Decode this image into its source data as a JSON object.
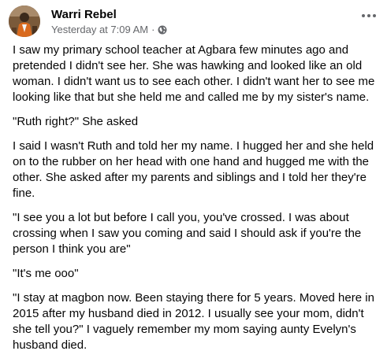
{
  "post": {
    "author": "Warri Rebel",
    "timestamp": "Yesterday at 7:09 AM",
    "separator": "·",
    "privacy_icon": "globe-icon",
    "more_icon": "more-options-icon",
    "paragraphs": [
      "I saw my primary school teacher at Agbara few minutes ago and\npretended I didn't see her. She was hawking and looked like an old\nwoman. I didn't want us to see each other. I didn't want her to see me\nlooking like that but she held me and called me by my sister's name.",
      "\"Ruth right?\" She asked",
      "I said I wasn't Ruth and told her my name. I hugged her and she held\non to the rubber on her head with one hand and hugged me with the\nother. She asked after my parents and siblings and I told her they're\nfine.",
      "\"I see you a lot but before I call you, you've crossed. I was about\ncrossing when I saw you coming and said I should ask if you're the\nperson I think you are\"",
      "\"It's me ooo\"",
      "\"I stay at magbon now. Been staying there for 5 years. Moved here in\n2015 after my husband died in 2012. I usually see your mom, didn't\nshe tell you?\" I vaguely remember my mom saying aunty Evelyn's\nhusband died."
    ]
  },
  "colors": {
    "text": "#050505",
    "secondary": "#65676b",
    "background": "#ffffff"
  }
}
